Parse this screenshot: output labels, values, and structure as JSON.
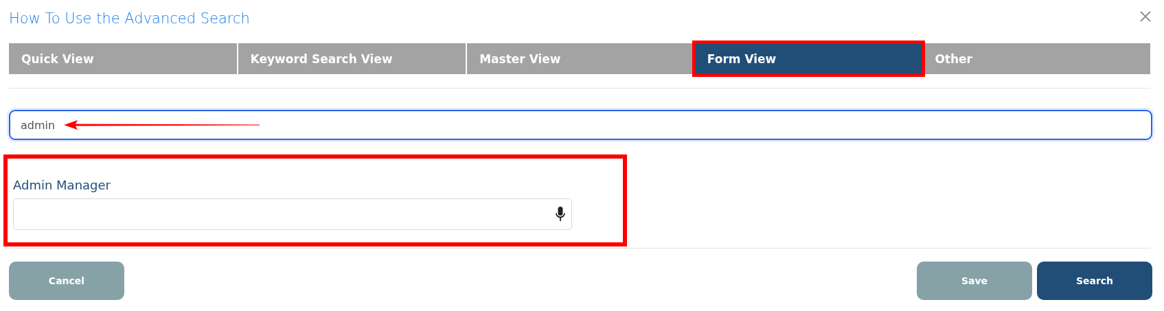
{
  "dialog": {
    "title": "How To Use the Advanced Search"
  },
  "tabs": [
    {
      "label": "Quick View",
      "selected": false,
      "highlighted": false
    },
    {
      "label": "Keyword Search View",
      "selected": false,
      "highlighted": false
    },
    {
      "label": "Master View",
      "selected": false,
      "highlighted": false
    },
    {
      "label": "Form View",
      "selected": true,
      "highlighted": true
    },
    {
      "label": "Other",
      "selected": false,
      "highlighted": false
    }
  ],
  "search": {
    "value": "admin",
    "annotated": true
  },
  "form": {
    "highlighted": true,
    "fields": [
      {
        "label": "Admin Manager",
        "kind": "voice"
      }
    ]
  },
  "buttons": [
    {
      "label": "Cancel",
      "kind": "secondary"
    },
    {
      "label": "Save",
      "kind": "secondary"
    },
    {
      "label": "Search",
      "kind": "primary"
    }
  ]
}
